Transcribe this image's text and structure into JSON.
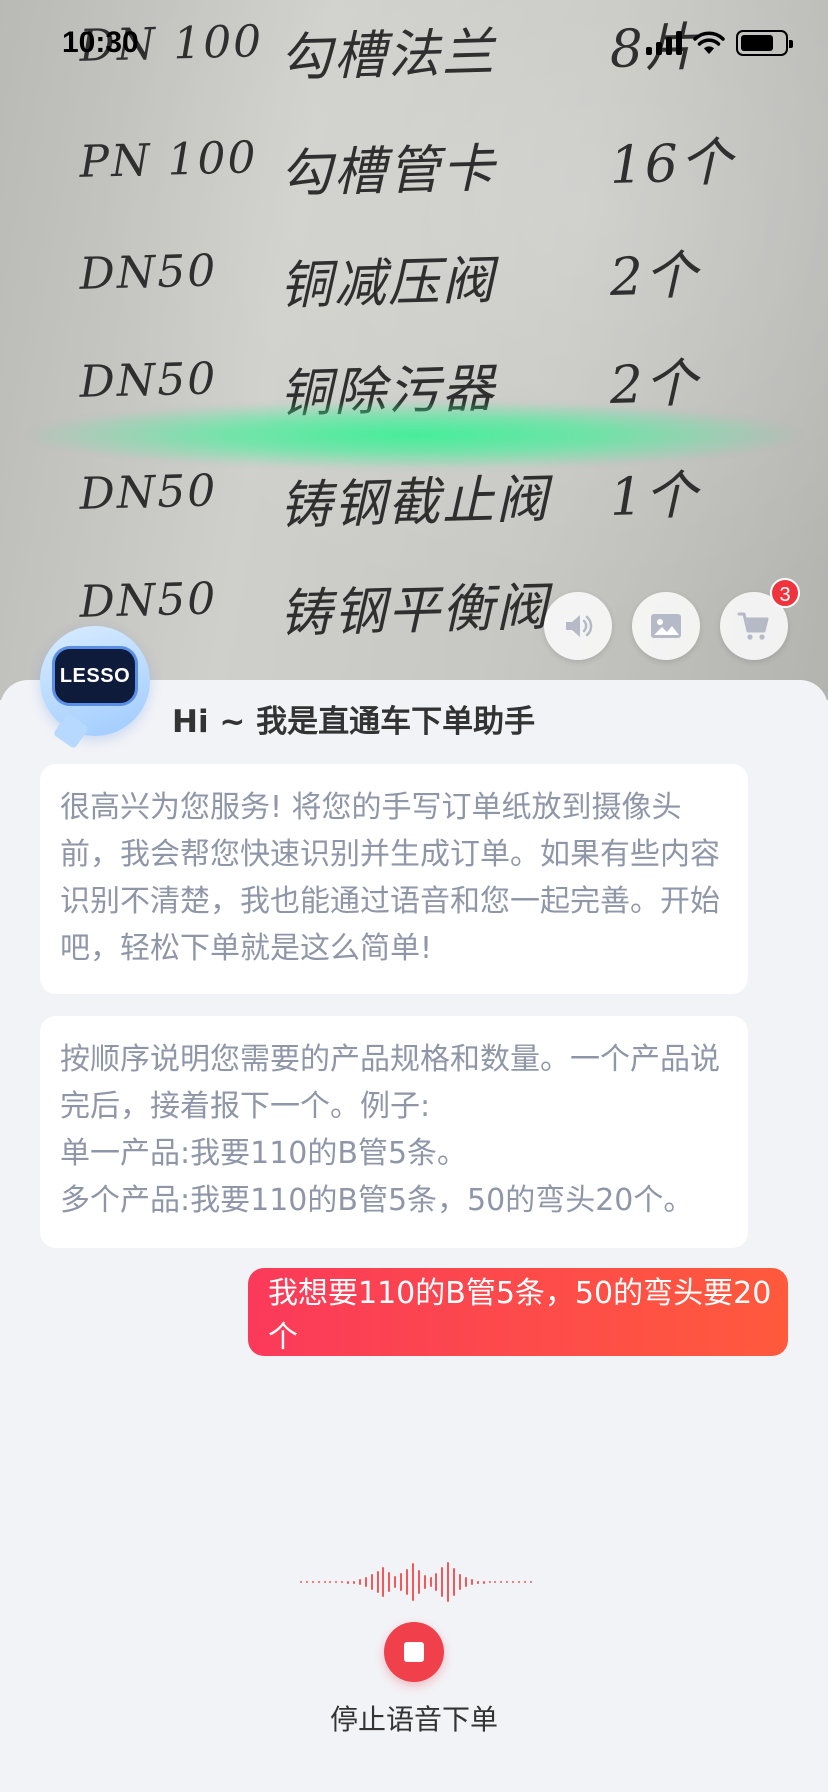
{
  "status_bar": {
    "time": "10:30"
  },
  "camera_view": {
    "handwritten_rows": [
      {
        "spec": "DN 100",
        "item": "勾槽法兰",
        "qty": "8片"
      },
      {
        "spec": "PN 100",
        "item": "勾槽管卡",
        "qty": "16个"
      },
      {
        "spec": "DN50",
        "item": "铜减压阀",
        "qty": "2个"
      },
      {
        "spec": "DN50",
        "item": "铜除污器",
        "qty": "2个"
      },
      {
        "spec": "DN50",
        "item": "铸钢截止阀",
        "qty": "1个"
      },
      {
        "spec": "DN50",
        "item": "铸钢平衡阀",
        "qty": ""
      }
    ],
    "scan_glow_color": "#3cf096"
  },
  "actions": {
    "sound_icon": "speaker-icon",
    "image_icon": "image-icon",
    "cart_icon": "cart-icon",
    "cart_badge": "3"
  },
  "assistant": {
    "logo_text": "LESSO",
    "greeting": "Hi ~ 我是直通车下单助手"
  },
  "messages": {
    "intro": "很高兴为您服务! 将您的手写订单纸放到摄像头前，我会帮您快速识别并生成订单。如果有些内容识别不清楚，我也能通过语音和您一起完善。开始吧，轻松下单就是这么简单!",
    "instructions": "按顺序说明您需要的产品规格和数量。一个产品说完后，接着报下一个。例子:\n单一产品:我要110的B管5条。\n多个产品:我要110的B管5条，50的弯头20个。",
    "user": "我想要110的B管5条，50的弯头要20个"
  },
  "voice": {
    "stop_label": "停止语音下单"
  },
  "colors": {
    "accent": "#f0404c",
    "user_bubble_start": "#fb3a5a",
    "user_bubble_end": "#ff5a3c",
    "assistant_text": "#8f96a8"
  }
}
